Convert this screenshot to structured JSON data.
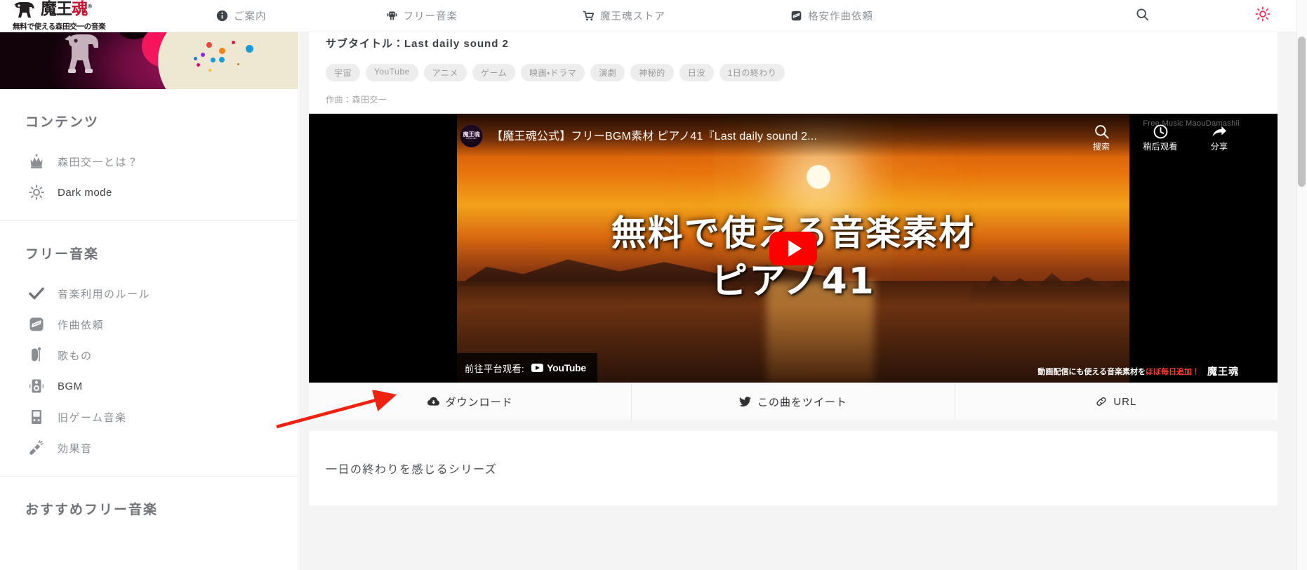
{
  "header": {
    "brand_mark": "魔王",
    "brand_mark_accent": "魂",
    "brand_reg": "®",
    "brand_sub": "無料で使える森田交一の音楽",
    "nav": [
      {
        "label": "ご案内",
        "icon": "info-icon"
      },
      {
        "label": "フリー音楽",
        "icon": "robot-icon"
      },
      {
        "label": "魔王魂ストア",
        "icon": "cart-icon"
      },
      {
        "label": "格安作曲依頼",
        "icon": "note-square-icon"
      }
    ],
    "search_icon": "search-icon",
    "theme_icon": "sun-icon",
    "theme_color": "#ef2d56"
  },
  "sidebar": {
    "sections": [
      {
        "title": "コンテンツ",
        "items": [
          {
            "label": "森田交一とは？",
            "icon": "crown-icon",
            "active": false
          },
          {
            "label": "Dark mode",
            "icon": "sun-icon",
            "active": true
          }
        ]
      },
      {
        "title": "フリー音楽",
        "items": [
          {
            "label": "音楽利用のルール",
            "icon": "check-icon",
            "active": false
          },
          {
            "label": "作曲依頼",
            "icon": "note-square-icon",
            "active": false
          },
          {
            "label": "歌もの",
            "icon": "singer-icon",
            "active": false
          },
          {
            "label": "BGM",
            "icon": "speaker-icon",
            "active": true
          },
          {
            "label": "旧ゲーム音楽",
            "icon": "gameboy-icon",
            "active": false
          },
          {
            "label": "効果音",
            "icon": "megaphone-icon",
            "active": false
          }
        ]
      },
      {
        "title": "おすすめフリー音楽",
        "items": []
      }
    ]
  },
  "article": {
    "title": "ピアノ41",
    "subtitle": "サブタイトル：Last daily sound 2",
    "tags": [
      "宇宙",
      "YouTube",
      "アニメ",
      "ゲーム",
      "映画・ドラマ",
      "演劇",
      "神秘的",
      "日没",
      "1日の終わり"
    ],
    "credit": "作曲：森田交一",
    "description": "一日の終わりを感じるシリーズ"
  },
  "video": {
    "channel_badge": "魔王魂",
    "channel_badge_sub": "official",
    "title": "【魔王魂公式】フリーBGM素材 ピアノ41『Last daily sound 2...",
    "watermark": "Free Music MaouDamashii",
    "controls": [
      {
        "label": "搜索",
        "icon": "search-icon"
      },
      {
        "label": "稍后观看",
        "icon": "clock-icon"
      },
      {
        "label": "分享",
        "icon": "share-icon"
      }
    ],
    "thumbnail_line1": "無料で使える音楽素材",
    "thumbnail_line2": "ピアノ41",
    "watch_on_label": "前往平台观看:",
    "youtube_label": "YouTube",
    "footer_text_1": "動画配信にも使える音楽素材を",
    "footer_text_accent": "ほぼ毎日追加！",
    "footer_text_2": "魔王魂",
    "play_button": "play-button"
  },
  "actions": [
    {
      "label": "ダウンロード",
      "icon": "cloud-download-icon"
    },
    {
      "label": "この曲をツイート",
      "icon": "twitter-icon"
    },
    {
      "label": "URL",
      "icon": "link-icon"
    }
  ],
  "annotation": {
    "type": "red-arrow",
    "points_to": "ダウンロード"
  }
}
